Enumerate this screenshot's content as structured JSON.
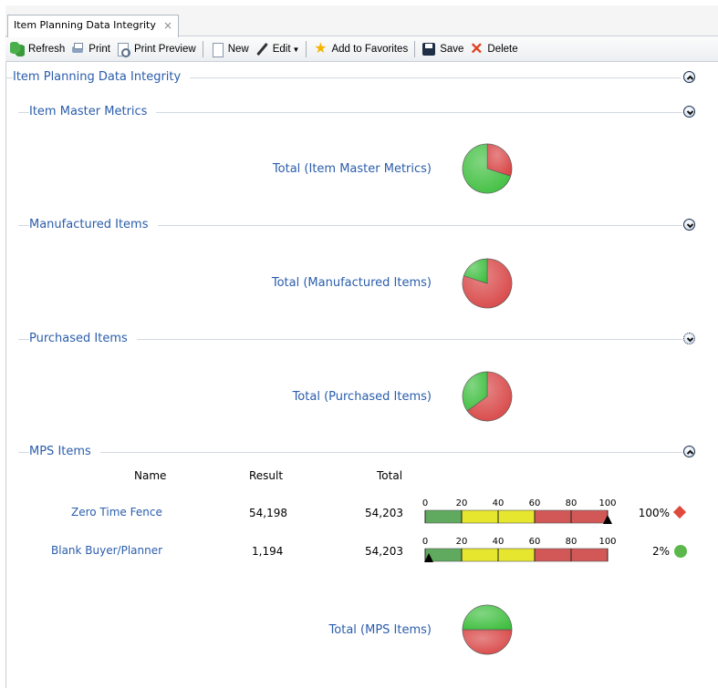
{
  "tab": {
    "title": "Item Planning Data Integrity",
    "close": "×"
  },
  "toolbar": {
    "refresh": "Refresh",
    "print": "Print",
    "print_preview": "Print Preview",
    "new": "New",
    "edit": "Edit",
    "add_to_favorites": "Add to Favorites",
    "save": "Save",
    "delete": "Delete"
  },
  "page": {
    "title": "Item Planning Data Integrity",
    "collapsed": false
  },
  "sections": {
    "item_master": {
      "title": "Item Master Metrics",
      "chart_label": "Total (Item Master Metrics)",
      "chart_data": {
        "type": "pie",
        "slices": [
          {
            "label": "red",
            "fraction": 0.3,
            "color": "#d84545"
          },
          {
            "label": "green",
            "fraction": 0.7,
            "color": "#3fbf3f"
          }
        ]
      }
    },
    "manufactured": {
      "title": "Manufactured Items",
      "chart_label": "Total (Manufactured Items)",
      "chart_data": {
        "type": "pie",
        "slices": [
          {
            "label": "red",
            "fraction": 0.8,
            "color": "#d84545"
          },
          {
            "label": "green",
            "fraction": 0.2,
            "color": "#3fbf3f"
          }
        ]
      }
    },
    "purchased": {
      "title": "Purchased Items",
      "chart_label": "Total (Purchased Items)",
      "chart_data": {
        "type": "pie",
        "slices": [
          {
            "label": "red",
            "fraction": 0.65,
            "color": "#d84545"
          },
          {
            "label": "green",
            "fraction": 0.35,
            "color": "#3fbf3f"
          }
        ]
      }
    },
    "mps": {
      "title": "MPS Items",
      "columns": {
        "name": "Name",
        "result": "Result",
        "total": "Total"
      },
      "gauge_ticks": [
        "0",
        "20",
        "40",
        "60",
        "80",
        "100"
      ],
      "rows": [
        {
          "name": "Zero Time Fence",
          "result": "54,198",
          "total": "54,203",
          "percent_label": "100%",
          "value": 100,
          "indicator": "red-diamond"
        },
        {
          "name": "Blank Buyer/Planner",
          "result": "1,194",
          "total": "54,203",
          "percent_label": "2%",
          "value": 2,
          "indicator": "green-circle"
        }
      ],
      "chart_label": "Total (MPS Items)",
      "chart_data": {
        "type": "pie",
        "slices": [
          {
            "label": "red",
            "fraction": 0.5,
            "color": "#d84545"
          },
          {
            "label": "green",
            "fraction": 0.5,
            "color": "#3fbf3f"
          }
        ]
      }
    }
  },
  "colors": {
    "accent_blue": "#2a5dab",
    "gauge_green": "#5faa5f",
    "gauge_yellow": "#e6e62e",
    "gauge_red": "#d25858"
  }
}
